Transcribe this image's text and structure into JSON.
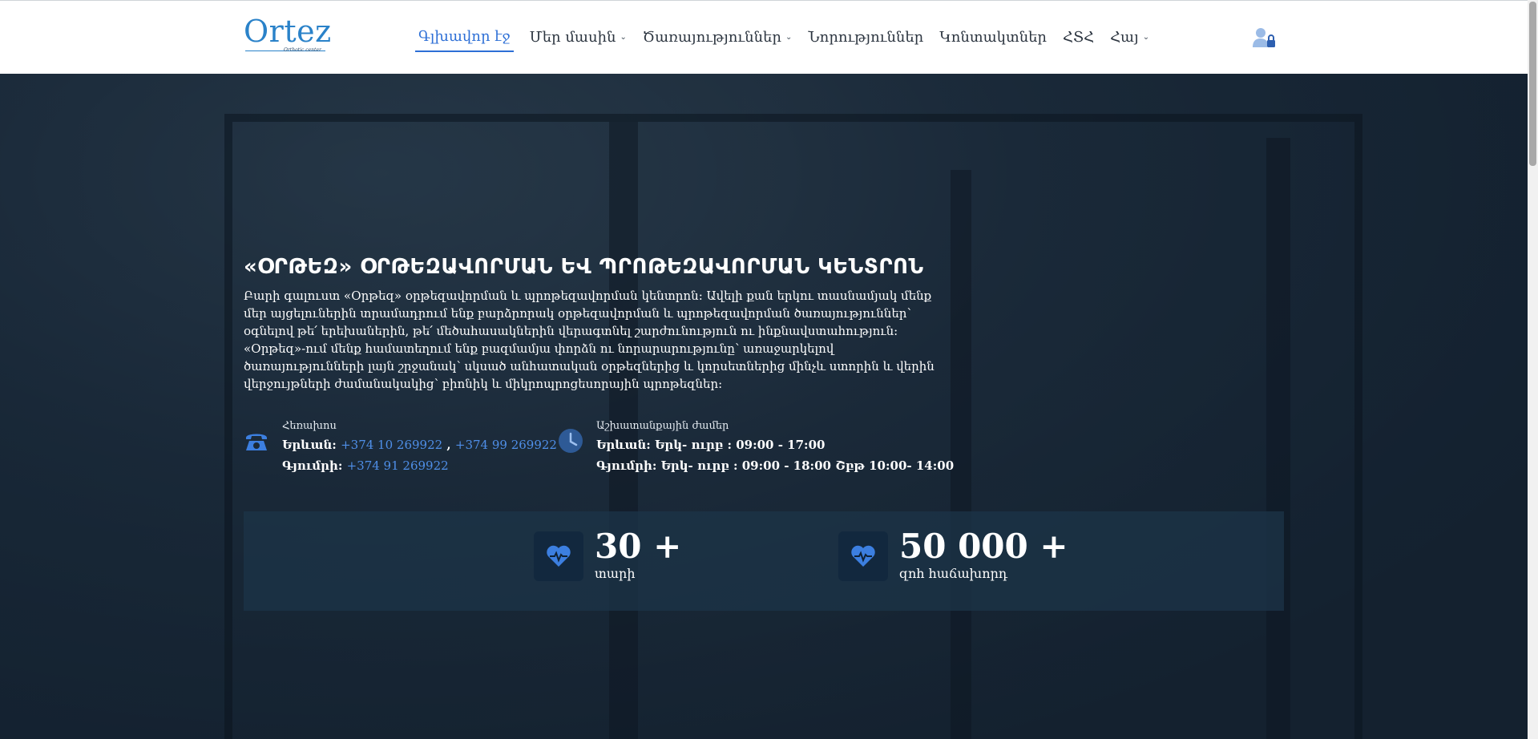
{
  "brand": {
    "logo_text": "Ortez",
    "logo_subtext": "Orthotic center",
    "accent": "#2d6fd6"
  },
  "nav": {
    "items": [
      {
        "label": "Գլխավոր էջ",
        "dropdown": false,
        "active": true
      },
      {
        "label": "Մեր մասին",
        "dropdown": true,
        "active": false
      },
      {
        "label": "Ծառայություններ",
        "dropdown": true,
        "active": false
      },
      {
        "label": "Նորություններ",
        "dropdown": false,
        "active": false
      },
      {
        "label": "Կոնտակտներ",
        "dropdown": false,
        "active": false
      },
      {
        "label": "ՀՏՀ",
        "dropdown": false,
        "active": false
      },
      {
        "label": "Հայ",
        "dropdown": true,
        "active": false
      }
    ],
    "user_icon": "user-lock-icon"
  },
  "hero": {
    "title": "«ՕՐԹԵԶ» ՕՐԹԵԶԱՎՈՐՄԱՆ ԵՎ ՊՐՈԹԵԶԱՎՈՐՄԱՆ ԿԵՆՏՐՈՆ",
    "description": "Բարի գալուստ «Օրթեզ» օրթեզավորման և պրոթեզավորման կենտրոն: Ավելի քան երկու տասնամյակ մենք մեր այցելուներին տրամադրում ենք բարձրորակ օրթեզավորման և պրոթեզավորման ծառայություններ՝ օգնելով թե՛ երեխաներին, թե՛ մեծահասակներին վերագտնել շարժունություն ու ինքնավստահություն: «Օրթեզ»-ում մենք համատեղում ենք բազմամյա փորձն ու նորարարությունը՝ առաջարկելով ծառայությունների լայն շրջանակ՝ սկսած անհատական օրթեզներից և կորսետներից մինչև ստորին և վերին վերջույթների ժամանակակից՝ բիոնիկ և միկրոպրոցեսորային պրոթեզներ:"
  },
  "phone": {
    "icon": "phone-icon",
    "label": "Հեռախոս",
    "yerevan_label": "Երևան:",
    "yerevan_phone_1": "+374 10 269922",
    "separator": ",",
    "yerevan_phone_2": "+374 99 269922",
    "gyumri_label": "Գյումրի:",
    "gyumri_phone": "+374 91 269922"
  },
  "hours": {
    "icon": "clock-icon",
    "label": "Աշխատանքային ժամեր",
    "line1": "Երևան: Երկ- ուրբ : 09:00 - 17:00",
    "line2": "Գյումրի: Երկ- ուրբ : 09:00 - 18:00 Շբթ 10:00- 14:00"
  },
  "stats": [
    {
      "icon": "heart-pulse-icon",
      "number": "30 +",
      "label": "տարի"
    },
    {
      "icon": "heart-pulse-icon",
      "number": "50 000 +",
      "label": "զոհ հաճախորդ"
    }
  ]
}
